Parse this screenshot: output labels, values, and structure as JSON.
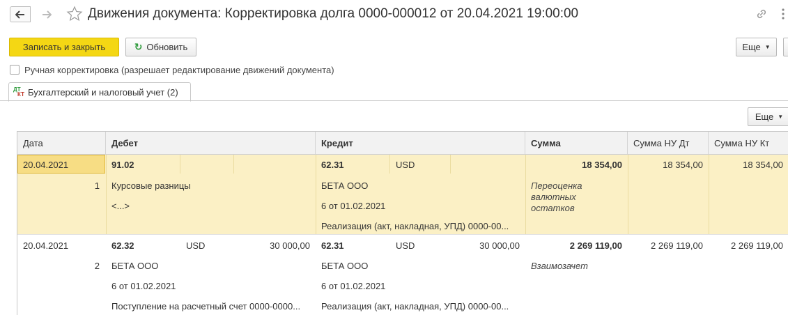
{
  "window": {
    "title": "Движения документа: Корректировка долга 0000-000012 от 20.04.2021 19:00:00"
  },
  "icons": {
    "back": "arrow-left-icon",
    "forward": "arrow-right-icon",
    "favorite": "star-icon",
    "link": "link-icon",
    "more": "vertical-dots-icon",
    "refresh": "refresh-icon",
    "tab": "dt-kt-icon"
  },
  "toolbar": {
    "save_close_label": "Записать и закрыть",
    "refresh_label": "Обновить",
    "more_label": "Еще"
  },
  "manual_correction": {
    "label": "Ручная корректировка (разрешает редактирование движений документа)",
    "checked": false
  },
  "tabs": [
    {
      "label": "Бухгалтерский и налоговый учет (2)",
      "active": true
    }
  ],
  "table_toolbar": {
    "more_label": "Еще"
  },
  "table": {
    "columns": [
      "Дата",
      "Дебет",
      "Кредит",
      "Сумма",
      "Сумма НУ Дт",
      "Сумма НУ Кт"
    ],
    "rows": [
      {
        "date": "20.04.2021",
        "number": "1",
        "debit_account": "91.02",
        "debit_currency": "",
        "debit_amount": "",
        "debit_sub1": "Курсовые разницы",
        "debit_sub2": "<...>",
        "debit_sub3": "",
        "credit_account": "62.31",
        "credit_currency": "USD",
        "credit_amount": "",
        "credit_sub1": "БЕТА ООО",
        "credit_sub2": "6 от 01.02.2021",
        "credit_sub3": "Реализация (акт, накладная, УПД) 0000-00...",
        "sum": "18 354,00",
        "content": "Переоценка валютных остатков",
        "nu_dt": "18 354,00",
        "nu_kt": "18 354,00",
        "selected": true
      },
      {
        "date": "20.04.2021",
        "number": "2",
        "debit_account": "62.32",
        "debit_currency": "USD",
        "debit_amount": "30 000,00",
        "debit_sub1": "БЕТА ООО",
        "debit_sub2": "6 от 01.02.2021",
        "debit_sub3": "Поступление на расчетный счет 0000-0000...",
        "credit_account": "62.31",
        "credit_currency": "USD",
        "credit_amount": "30 000,00",
        "credit_sub1": "БЕТА ООО",
        "credit_sub2": "6 от 01.02.2021",
        "credit_sub3": "Реализация (акт, накладная, УПД) 0000-00...",
        "sum": "2 269 119,00",
        "content": "Взаимозачет",
        "nu_dt": "2 269 119,00",
        "nu_kt": "2 269 119,00",
        "selected": false
      }
    ]
  },
  "colors": {
    "primary_button": "#f4d714",
    "selected_row": "#fbf0c5",
    "selected_cell": "#f7dd84",
    "refresh_icon": "#2e9a3b"
  }
}
